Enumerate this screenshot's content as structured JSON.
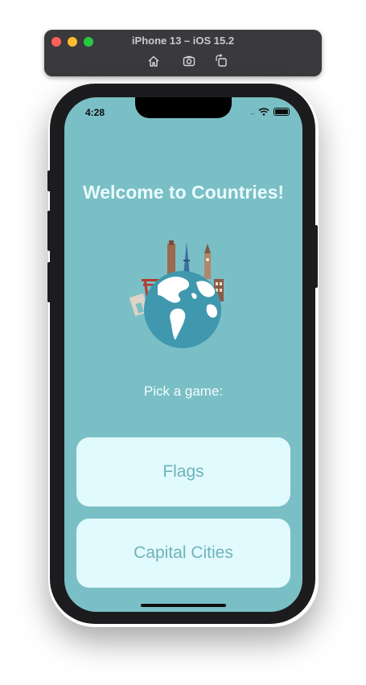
{
  "simulator": {
    "title": "iPhone 13 – iOS 15.2",
    "icons": [
      "home-icon",
      "screenshot-icon",
      "rotate-icon"
    ]
  },
  "status_bar": {
    "time": "4:28",
    "signal": "....",
    "icons": [
      "wifi-icon",
      "battery-icon"
    ]
  },
  "main": {
    "title": "Welcome to Countries!",
    "subtitle": "Pick a game:",
    "buttons": [
      {
        "label": "Flags"
      },
      {
        "label": "Capital Cities"
      }
    ]
  },
  "colors": {
    "screen_background": "#7abfc6",
    "button_background": "#e1fafd",
    "button_text": "#6fb3bb",
    "title_text": "#e9fbfc"
  }
}
